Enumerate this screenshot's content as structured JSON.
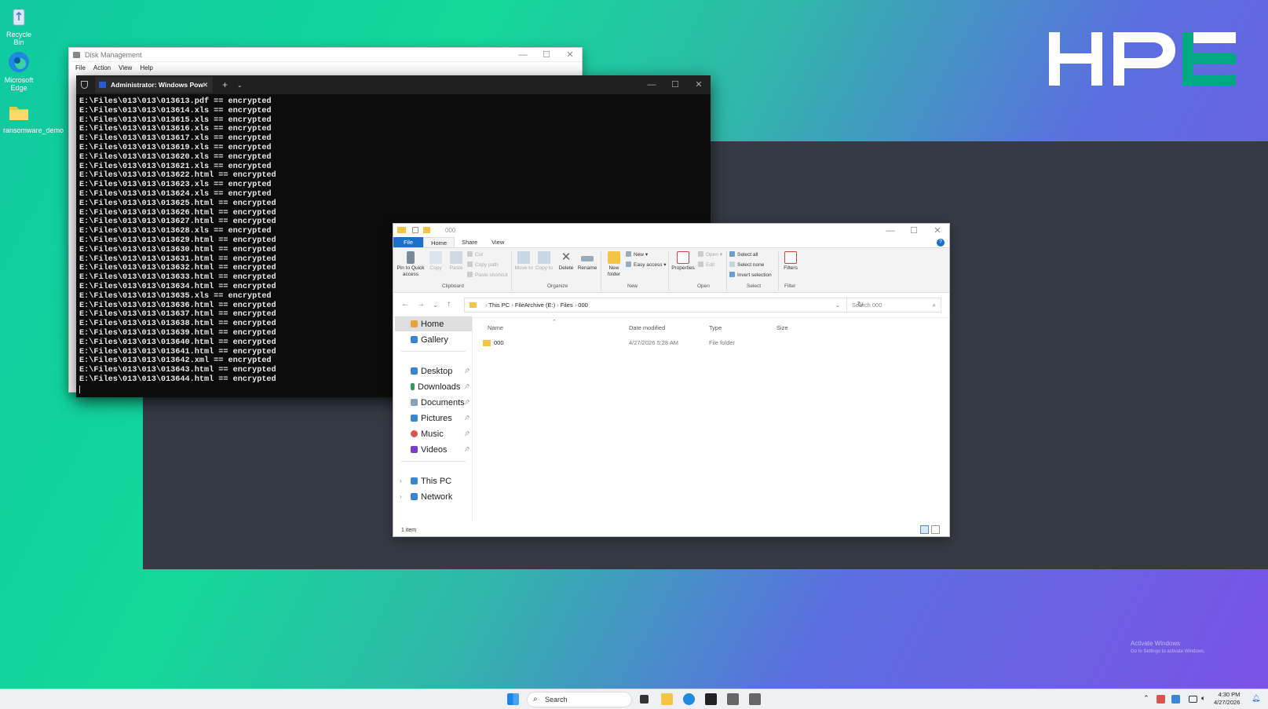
{
  "desktop": {
    "icons": [
      {
        "label": "Recycle Bin",
        "icon": "recycle-bin-icon"
      },
      {
        "label": "Microsoft Edge",
        "icon": "edge-icon"
      },
      {
        "label": "ransomware_demo",
        "icon": "folder-icon"
      }
    ],
    "logo": "HPE",
    "watermark": {
      "title": "Activate Windows",
      "subtitle": "Go to Settings to activate Windows."
    }
  },
  "disk_management": {
    "title": "Disk Management",
    "menu": [
      "File",
      "Action",
      "View",
      "Help"
    ]
  },
  "terminal": {
    "tab_title": "Administrator: Windows Pow",
    "lines": [
      "E:\\Files\\013\\013\\013613.pdf == encrypted",
      "E:\\Files\\013\\013\\013614.xls == encrypted",
      "E:\\Files\\013\\013\\013615.xls == encrypted",
      "E:\\Files\\013\\013\\013616.xls == encrypted",
      "E:\\Files\\013\\013\\013617.xls == encrypted",
      "E:\\Files\\013\\013\\013619.xls == encrypted",
      "E:\\Files\\013\\013\\013620.xls == encrypted",
      "E:\\Files\\013\\013\\013621.xls == encrypted",
      "E:\\Files\\013\\013\\013622.html == encrypted",
      "E:\\Files\\013\\013\\013623.xls == encrypted",
      "E:\\Files\\013\\013\\013624.xls == encrypted",
      "E:\\Files\\013\\013\\013625.html == encrypted",
      "E:\\Files\\013\\013\\013626.html == encrypted",
      "E:\\Files\\013\\013\\013627.html == encrypted",
      "E:\\Files\\013\\013\\013628.xls == encrypted",
      "E:\\Files\\013\\013\\013629.html == encrypted",
      "E:\\Files\\013\\013\\013630.html == encrypted",
      "E:\\Files\\013\\013\\013631.html == encrypted",
      "E:\\Files\\013\\013\\013632.html == encrypted",
      "E:\\Files\\013\\013\\013633.html == encrypted",
      "E:\\Files\\013\\013\\013634.html == encrypted",
      "E:\\Files\\013\\013\\013635.xls == encrypted",
      "E:\\Files\\013\\013\\013636.html == encrypted",
      "E:\\Files\\013\\013\\013637.html == encrypted",
      "E:\\Files\\013\\013\\013638.html == encrypted",
      "E:\\Files\\013\\013\\013639.html == encrypted",
      "E:\\Files\\013\\013\\013640.html == encrypted",
      "E:\\Files\\013\\013\\013641.html == encrypted",
      "E:\\Files\\013\\013\\013642.xml == encrypted",
      "E:\\Files\\013\\013\\013643.html == encrypted",
      "E:\\Files\\013\\013\\013644.html == encrypted"
    ]
  },
  "explorer": {
    "title": "000",
    "tabs": [
      "File",
      "Home",
      "Share",
      "View"
    ],
    "ribbon": {
      "pin": "Pin to Quick access",
      "copy": "Copy",
      "paste": "Paste",
      "cut": "Cut",
      "copy_path": "Copy path",
      "paste_shortcut": "Paste shortcut",
      "clipboard": "Clipboard",
      "move_to": "Move to",
      "copy_to": "Copy to",
      "delete": "Delete",
      "rename": "Rename",
      "organize": "Organize",
      "new_folder": "New folder",
      "new_item": "New",
      "easy_access": "Easy access",
      "new_group": "New",
      "properties": "Properties",
      "open": "Open",
      "edit": "Edit",
      "open_group": "Open",
      "select_all": "Select all",
      "select_none": "Select none",
      "invert_selection": "Invert selection",
      "select_group": "Select",
      "filters": "Filters",
      "filter_group": "Filter"
    },
    "breadcrumb": [
      "This PC",
      "FileArchive (E:)",
      "Files",
      "000"
    ],
    "search_placeholder": "Search 000",
    "nav": {
      "home": "Home",
      "gallery": "Gallery",
      "desktop": "Desktop",
      "downloads": "Downloads",
      "documents": "Documents",
      "pictures": "Pictures",
      "music": "Music",
      "videos": "Videos",
      "this_pc": "This PC",
      "network": "Network"
    },
    "columns": [
      "Name",
      "Date modified",
      "Type",
      "Size"
    ],
    "rows": [
      {
        "name": "000",
        "date": "4/27/2026 5:28 AM",
        "type": "File folder",
        "size": ""
      }
    ],
    "status": "1 item"
  },
  "taskbar": {
    "search": "Search",
    "time": "4:30 PM",
    "date": "4/27/2026"
  },
  "colors": {
    "accent": "#1a6fc9",
    "terminal_bg": "#0c0c0c",
    "hpe_green": "#01a982"
  }
}
